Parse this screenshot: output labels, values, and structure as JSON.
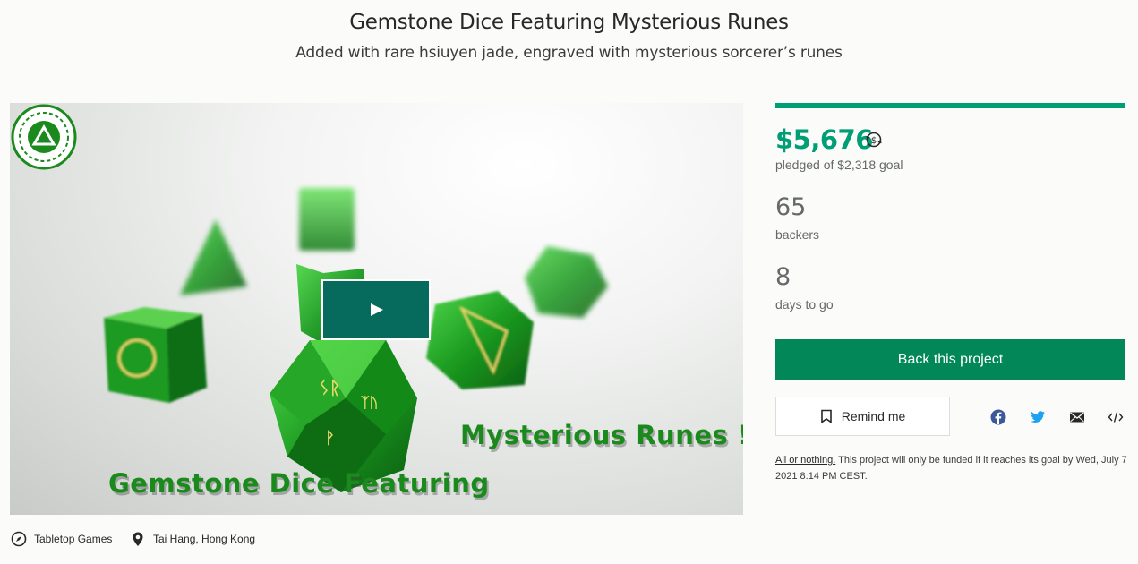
{
  "header": {
    "title": "Gemstone Dice Featuring Mysterious Runes",
    "subtitle": "Added with rare hsiuyen jade, engraved with mysterious sorcerer’s runes"
  },
  "video": {
    "overlay_line1": "Mysterious Runes !",
    "overlay_line2": "Gemstone Dice Featuring",
    "play_icon": "play-icon"
  },
  "meta": {
    "category": "Tabletop Games",
    "category_icon": "compass-icon",
    "location": "Tai Hang, Hong Kong",
    "location_icon": "map-pin-icon"
  },
  "stats": {
    "pledged": "$5,676",
    "goal_text": "pledged of $2,318 goal",
    "funded_fraction": 1.0,
    "backers_count": "65",
    "backers_label": "backers",
    "days_count": "8",
    "days_label": "days to go"
  },
  "actions": {
    "back_label": "Back this project",
    "remind_label": "Remind me",
    "share_icons": [
      "facebook-icon",
      "twitter-icon",
      "email-icon",
      "embed-icon"
    ]
  },
  "fine_print": {
    "link": "All or nothing.",
    "text": " This project will only be funded if it reaches its goal by Wed, July 7 2021 8:14 PM CEST."
  },
  "colors": {
    "accent_green": "#009e74",
    "button_green": "#028858",
    "play_button": "#066a5c"
  }
}
